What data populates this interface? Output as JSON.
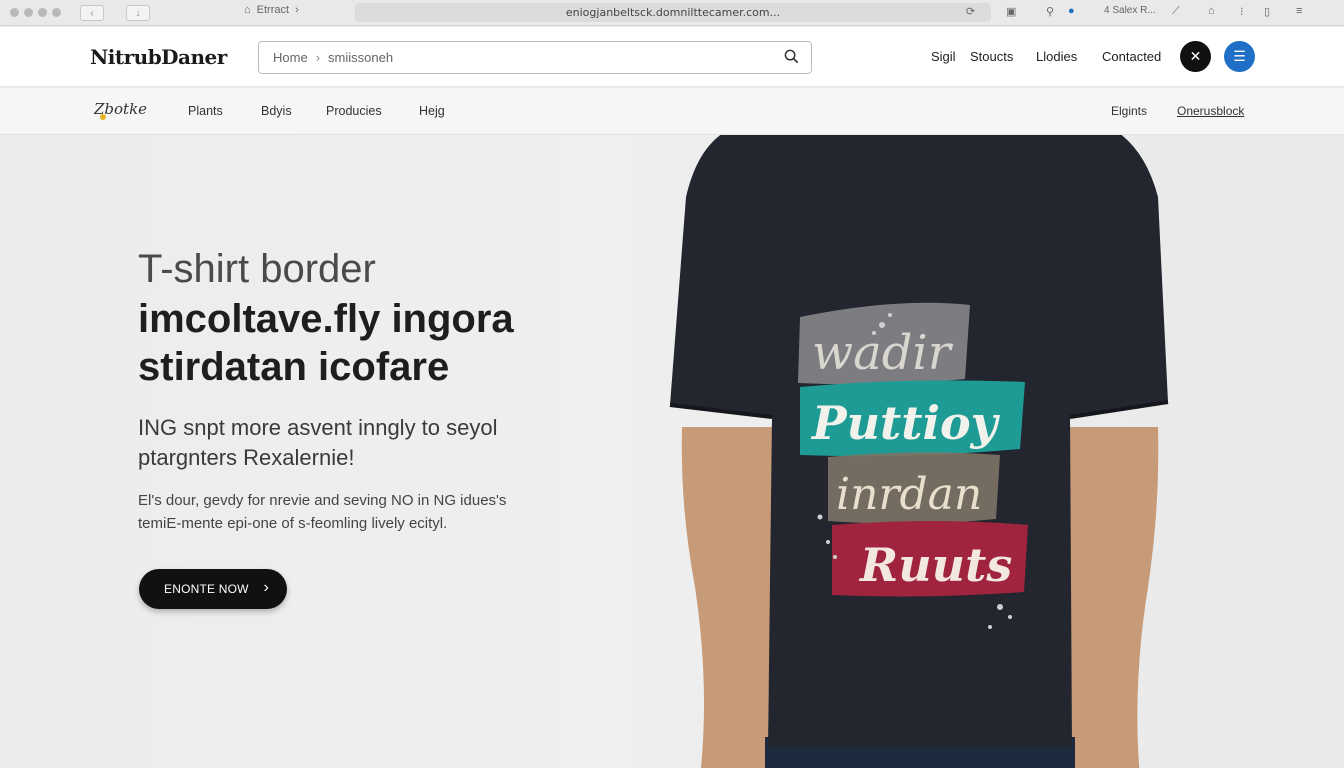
{
  "browser": {
    "crumb": "Etrract",
    "url": "eniogjanbeltsck.domnilttecamer.com...",
    "right_label": "4 Salex R..."
  },
  "header": {
    "logo": "NitrubDaner",
    "search": {
      "home": "Home",
      "query": "smiissoneh"
    },
    "nav": [
      "Sigil",
      "Stoucts",
      "Llodies",
      "Contacted"
    ]
  },
  "subnav": {
    "logo": "Zbotke",
    "items": [
      "Plants",
      "Bdyis",
      "Producies",
      "Hejg"
    ],
    "right": [
      "Elgints",
      "Onerusblock"
    ]
  },
  "hero": {
    "title_line1": "T-shirt border",
    "title_line2": "imcoltave.fly ingora",
    "title_line3": "stirdatan icofare",
    "lead_line1": "ING snpt more asvent inngly to seyol",
    "lead_line2": "ptargnters Rexalernie!",
    "body_line1": "El's dour, gevdy for nrevie and seving NO in NG idues's",
    "body_line2": "temiE-mente epi-one of s-feomling lively ecityl.",
    "cta": "ENONTE NOW"
  },
  "shirt": {
    "words": [
      "wadir",
      "Puttioy",
      "inrdan",
      "Ruuts"
    ]
  },
  "colors": {
    "shirt": "#23262f",
    "teal": "#1f9b95",
    "maroon": "#a0243e",
    "accent_blue": "#1f6fc6"
  }
}
